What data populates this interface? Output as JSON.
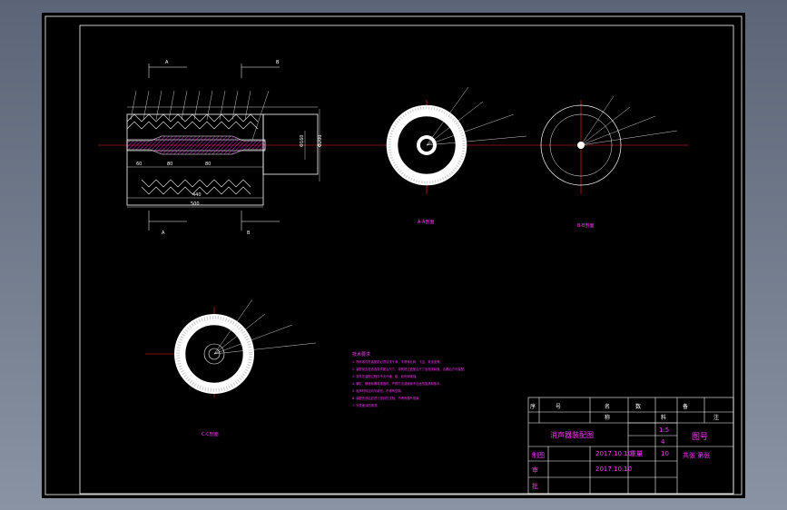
{
  "colors": {
    "background": "#000000",
    "frame": "#ffffff",
    "centerline": "#ff2020",
    "annotation": "#ff33ff",
    "hatch": "#ff33ff",
    "workspace": "#6f7a8b"
  },
  "title_block": {
    "drawing_name": "消声器装配图",
    "drawing_no": "图号",
    "header_row": [
      "序",
      "号",
      "名",
      "称",
      "数",
      "料",
      "备",
      "注"
    ],
    "rows": {
      "draw_label": "制图",
      "draw_date": "2017.10.10",
      "check_label": "审",
      "check_date": "2017.10.10",
      "approve_label": "批",
      "scale_value": "1:5",
      "weight_value": "4",
      "qty_value": "10",
      "sheet_label": "共张 第张",
      "extra_label": "重量"
    }
  },
  "views": {
    "section_a_label": "A-A剖面",
    "section_b_label": "B-B剖面",
    "section_c_label": "C-C剖面"
  },
  "notes": {
    "lines": [
      "技术要求",
      "1. 所有零件在装配前必须清洗干净，不得有毛刺、飞边、氧化皮等。",
      "2. 装配前应检查各零件配合尺寸，特别是过盈配合尺寸及相关精度，合格后方可装配。",
      "3. 零件在装配过程中不允许磕、碰、划伤和锈蚀。",
      "4. 螺钉、螺栓和螺母紧固时，严禁打击或使用不合适的旋具和扳手。",
      "5. 吸声材料应均匀填充，不得有空隙。",
      "6. 装配完成后应进行密封性试验，不得有漏气现象。",
      "7. 外表面涂防锈漆。"
    ]
  },
  "dimensions": {
    "total_length": "500",
    "inner_length": "440",
    "left_len": "240",
    "seg1": "60",
    "seg2": "80",
    "seg3": "80",
    "diameter_outer": "Φ200",
    "diameter_mid": "Φ160",
    "pipe_d": "Φ50",
    "arrow_a": "A",
    "arrow_b": "B"
  }
}
